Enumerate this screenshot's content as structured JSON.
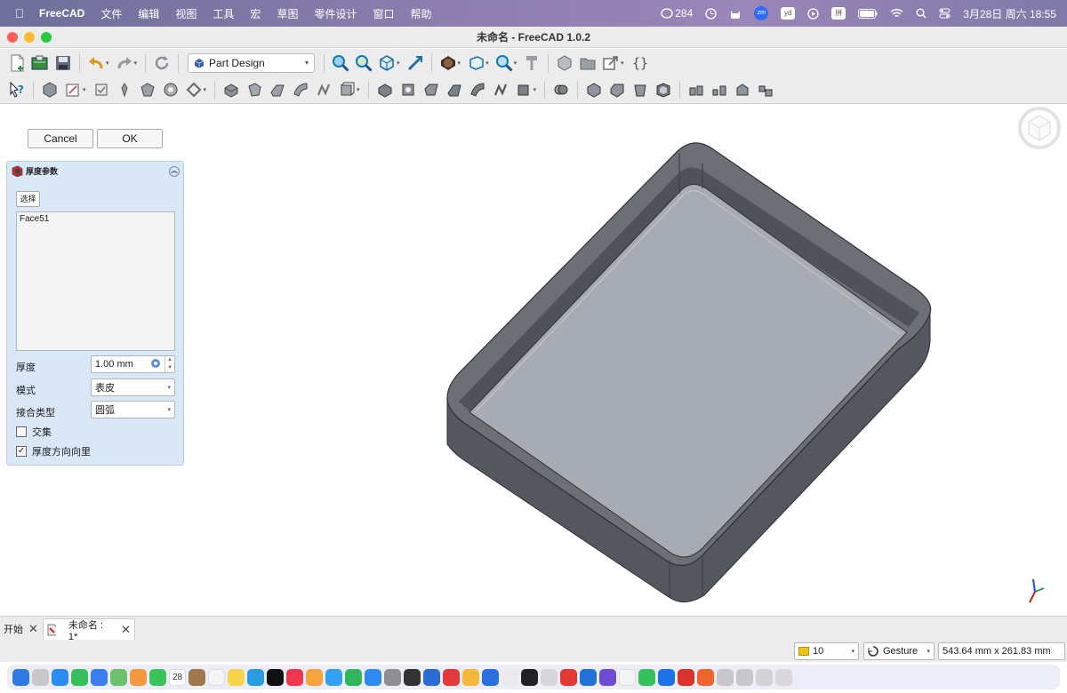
{
  "menubar": {
    "app_name": "FreeCAD",
    "items": [
      "文件",
      "编辑",
      "视图",
      "工具",
      "宏",
      "草图",
      "零件设计",
      "窗口",
      "帮助"
    ],
    "notification_count": "284",
    "ime_badge": "拼",
    "zoom_badge": "zm",
    "yd_badge": "yd",
    "clock": "3月28日 周六  18:55"
  },
  "window": {
    "title": "未命名 - FreeCAD 1.0.2"
  },
  "toolbar": {
    "workbench_selected": "Part Design"
  },
  "task_panel": {
    "cancel_label": "Cancel",
    "ok_label": "OK",
    "title": "厚度参数",
    "select_label": "选择",
    "faces": [
      "Face51"
    ],
    "thickness_label": "厚度",
    "thickness_value": "1.00 mm",
    "mode_label": "模式",
    "mode_value": "表皮",
    "join_label": "接合类型",
    "join_value": "圆弧",
    "intersection_label": "交集",
    "intersection_checked": false,
    "inward_label": "厚度方向向里",
    "inward_checked": true
  },
  "tabs": [
    {
      "label": "开始",
      "active": false
    },
    {
      "label": "未命名 : 1*",
      "active": true
    }
  ],
  "statusbar": {
    "grid_value": "10",
    "navigation_style": "Gesture",
    "dimensions": "543.64 mm x 261.83 mm"
  },
  "dock": {
    "calendar_day": "28"
  },
  "colors": {
    "shell_top": "#6c7076",
    "shell_wall": "#54585e",
    "shell_inner": "#a7acb4",
    "panel_bg": "#d9e7f7"
  }
}
